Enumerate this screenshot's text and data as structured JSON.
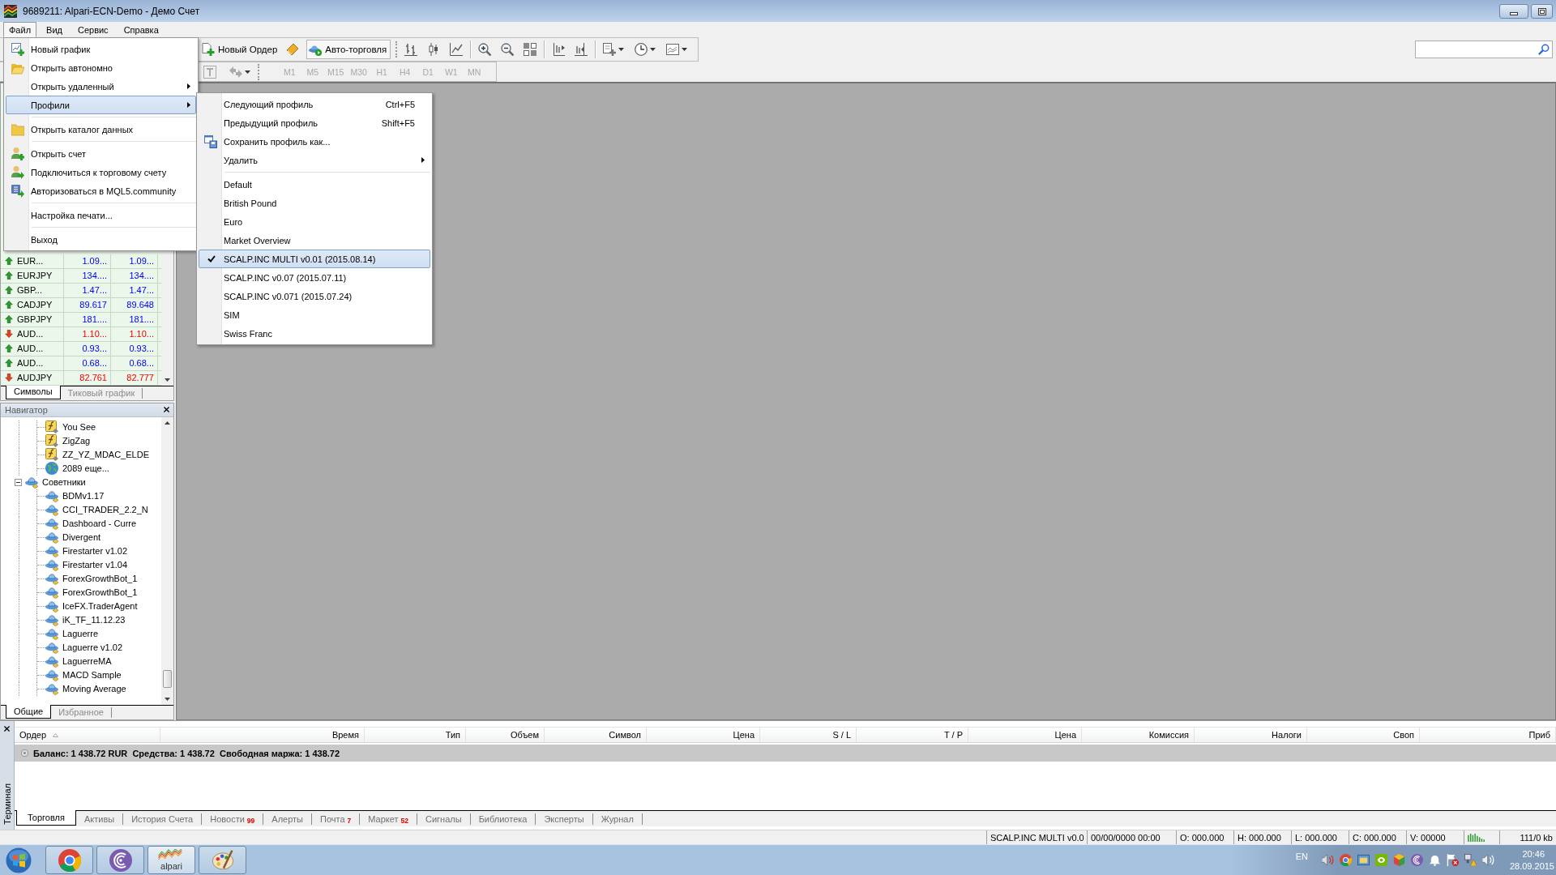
{
  "window": {
    "title": "9689211: Alpari-ECN-Demo - Демо Счет"
  },
  "menu_bar": [
    {
      "label": "Файл",
      "selected": true
    },
    {
      "label": "Вид",
      "selected": false
    },
    {
      "label": "Сервис",
      "selected": false
    },
    {
      "label": "Справка",
      "selected": false
    }
  ],
  "file_menu": [
    {
      "kind": "command",
      "label": "Новый график",
      "selected": false
    },
    {
      "kind": "command",
      "label": "Открыть автономно",
      "selected": false
    },
    {
      "kind": "submenu",
      "label": "Открыть удаленный",
      "selected": false
    },
    {
      "kind": "submenu",
      "label": "Профили",
      "selected": true
    },
    {
      "kind": "separator"
    },
    {
      "kind": "command",
      "label": "Открыть каталог данных",
      "selected": false
    },
    {
      "kind": "separator"
    },
    {
      "kind": "command",
      "label": "Открыть счет",
      "selected": false
    },
    {
      "kind": "command",
      "label": "Подключиться к торговому счету",
      "selected": false
    },
    {
      "kind": "command",
      "label": "Авторизоваться в MQL5.community",
      "selected": false
    },
    {
      "kind": "separator"
    },
    {
      "kind": "command",
      "label": "Настройка печати...",
      "selected": false
    },
    {
      "kind": "separator"
    },
    {
      "kind": "command",
      "label": "Выход",
      "selected": false
    }
  ],
  "profiles_menu": {
    "commands": [
      {
        "kind": "command",
        "label": "Следующий профиль",
        "shortcut": "Ctrl+F5"
      },
      {
        "kind": "command",
        "label": "Предыдущий профиль",
        "shortcut": "Shift+F5"
      },
      {
        "kind": "command",
        "label": "Сохранить профиль как..."
      },
      {
        "kind": "submenu",
        "label": "Удалить"
      }
    ],
    "profiles": [
      {
        "label": "Default",
        "checked": false,
        "selected": false
      },
      {
        "label": "British Pound",
        "checked": false,
        "selected": false
      },
      {
        "label": "Euro",
        "checked": false,
        "selected": false
      },
      {
        "label": "Market Overview",
        "checked": false,
        "selected": false
      },
      {
        "label": "SCALP.INC MULTI v0.01 (2015.08.14)",
        "checked": true,
        "selected": true
      },
      {
        "label": "SCALP.INC v0.07 (2015.07.11)",
        "checked": false,
        "selected": false
      },
      {
        "label": "SCALP.INC v0.071 (2015.07.24)",
        "checked": false,
        "selected": false
      },
      {
        "label": "SIM",
        "checked": false,
        "selected": false
      },
      {
        "label": "Swiss Franc",
        "checked": false,
        "selected": false
      }
    ]
  },
  "toolbar": {
    "new_order": "Новый Ордер",
    "auto_trading": {
      "label": "Авто-торговля",
      "on": true
    },
    "timeframes": [
      {
        "label": "M1",
        "disabled": true
      },
      {
        "label": "M5",
        "disabled": true
      },
      {
        "label": "M15",
        "disabled": true
      },
      {
        "label": "M30",
        "disabled": true
      },
      {
        "label": "H1",
        "disabled": true
      },
      {
        "label": "H4",
        "disabled": true
      },
      {
        "label": "D1",
        "disabled": true
      },
      {
        "label": "W1",
        "disabled": true
      },
      {
        "label": "MN",
        "disabled": true
      }
    ]
  },
  "market_watch": {
    "rows": [
      {
        "symbol": "EUR...",
        "bid": "1.09...",
        "ask": "1.09...",
        "rising": true
      },
      {
        "symbol": "EURJPY",
        "bid": "134....",
        "ask": "134....",
        "rising": true
      },
      {
        "symbol": "GBP...",
        "bid": "1.47...",
        "ask": "1.47...",
        "rising": true
      },
      {
        "symbol": "CADJPY",
        "bid": "89.617",
        "ask": "89.648",
        "rising": true
      },
      {
        "symbol": "GBPJPY",
        "bid": "181....",
        "ask": "181....",
        "rising": true
      },
      {
        "symbol": "AUD...",
        "bid": "1.10...",
        "ask": "1.10...",
        "rising": false
      },
      {
        "symbol": "AUD...",
        "bid": "0.93...",
        "ask": "0.93...",
        "rising": true
      },
      {
        "symbol": "AUD...",
        "bid": "0.68...",
        "ask": "0.68...",
        "rising": true
      },
      {
        "symbol": "AUDJPY",
        "bid": "82.761",
        "ask": "82.777",
        "rising": false
      }
    ],
    "tabs": [
      {
        "label": "Символы",
        "selected": true
      },
      {
        "label": "Тиковый график",
        "selected": false
      }
    ]
  },
  "navigator": {
    "title": "Навигатор",
    "tree": [
      {
        "children": [
          {
            "kind": "indicator",
            "label": "You See"
          },
          {
            "kind": "indicator",
            "label": "ZigZag"
          },
          {
            "kind": "indicator",
            "label": "ZZ_YZ_MDAC_ELDE"
          },
          {
            "kind": "more",
            "label": "2089 еще..."
          }
        ]
      },
      {
        "kind": "folder",
        "label": "Советники",
        "expanded": true,
        "children": [
          {
            "kind": "expert",
            "label": "BDMv1.17"
          },
          {
            "kind": "expert",
            "label": "CCI_TRADER_2.2_N"
          },
          {
            "kind": "expert",
            "label": "Dashboard - Curre"
          },
          {
            "kind": "expert",
            "label": "Divergent"
          },
          {
            "kind": "expert",
            "label": "Firestarter v1.02"
          },
          {
            "kind": "expert",
            "label": "Firestarter v1.04"
          },
          {
            "kind": "expert",
            "label": "ForexGrowthBot_1"
          },
          {
            "kind": "expert",
            "label": "ForexGrowthBot_1"
          },
          {
            "kind": "expert",
            "label": "IceFX.TraderAgent"
          },
          {
            "kind": "expert",
            "label": "iK_TF_11.12.23"
          },
          {
            "kind": "expert",
            "label": "Laguerre"
          },
          {
            "kind": "expert",
            "label": "Laguerre v1.02"
          },
          {
            "kind": "expert",
            "label": "LaguerreMA"
          },
          {
            "kind": "expert",
            "label": "MACD Sample"
          },
          {
            "kind": "expert",
            "label": "Moving Average"
          }
        ]
      }
    ],
    "tabs": [
      {
        "label": "Общие",
        "selected": true
      },
      {
        "label": "Избранное",
        "selected": false
      }
    ]
  },
  "terminal": {
    "title": "Терминал",
    "columns": [
      "Ордер",
      "Время",
      "Тип",
      "Объем",
      "Символ",
      "Цена",
      "S / L",
      "T / P",
      "Цена",
      "Комиссия",
      "Налоги",
      "Своп",
      "Приб"
    ],
    "balance": "Баланс: 1 438.72 RUR  Средства: 1 438.72  Свободная маржа: 1 438.72",
    "tabs": [
      {
        "label": "Торговля",
        "selected": true
      },
      {
        "label": "Активы",
        "selected": false
      },
      {
        "label": "История Счета",
        "selected": false
      },
      {
        "label": "Новости",
        "count": "99",
        "selected": false
      },
      {
        "label": "Алерты",
        "selected": false
      },
      {
        "label": "Почта",
        "count": "7",
        "selected": false
      },
      {
        "label": "Маркет",
        "count": "52",
        "selected": false
      },
      {
        "label": "Сигналы",
        "selected": false
      },
      {
        "label": "Библиотека",
        "selected": false
      },
      {
        "label": "Эксперты",
        "selected": false
      },
      {
        "label": "Журнал",
        "selected": false
      }
    ]
  },
  "status_bar": {
    "profile": "SCALP.INC MULTI v0.0",
    "time": "00/00/0000 00:00",
    "open": "O: 000.000",
    "high": "H: 000.000",
    "low": "L: 000.000",
    "close": "C: 000.000",
    "volume": "V: 00000",
    "traffic": "111/0 kb"
  },
  "taskbar": {
    "apps": [
      {
        "active": false
      },
      {
        "active": false
      },
      {
        "label": "alpari",
        "active": true
      },
      {
        "active": false
      }
    ],
    "language": "EN",
    "time": "20:46",
    "date": "28.09.2015"
  }
}
